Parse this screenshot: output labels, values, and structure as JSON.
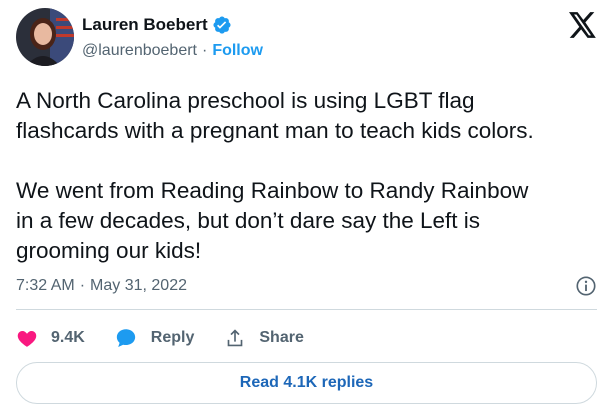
{
  "author": {
    "display_name": "Lauren Boebert",
    "handle": "@laurenboebert",
    "separator": "·",
    "follow_label": "Follow"
  },
  "tweet": {
    "text": "A North Carolina preschool is using LGBT flag\nflashcards with a pregnant man to teach kids colors.\n\nWe went from Reading Rainbow to Randy Rainbow\nin a few decades, but don’t dare say the Left is\ngrooming our kids!",
    "time": "7:32 AM",
    "date_separator": "·",
    "date": "May 31, 2022"
  },
  "actions": {
    "likes_count": "9.4K",
    "reply_label": "Reply",
    "share_label": "Share"
  },
  "replies_button": {
    "label": "Read 4.1K replies"
  },
  "colors": {
    "accent": "#1d9bf0",
    "like": "#f91880",
    "reply_icon": "#1d9bf0",
    "muted": "#536471",
    "border": "#cfd9de"
  },
  "icons": [
    "verified-badge-icon",
    "x-logo-icon",
    "info-icon",
    "heart-icon",
    "reply-bubble-icon",
    "share-icon"
  ]
}
